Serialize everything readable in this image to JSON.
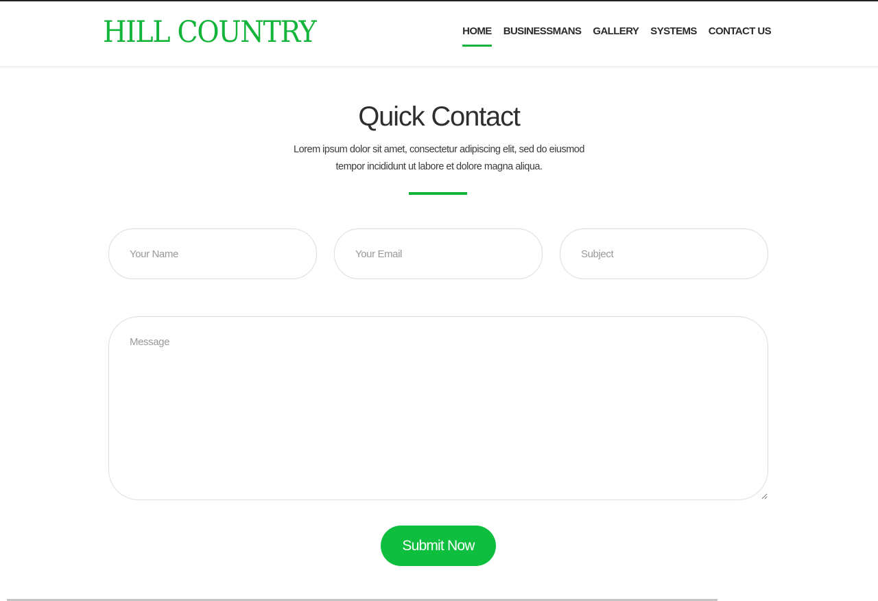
{
  "header": {
    "logo": "HILL COUNTRY",
    "nav": [
      {
        "label": "HOME",
        "active": true
      },
      {
        "label": "BUSINESSMANS",
        "active": false
      },
      {
        "label": "GALLERY",
        "active": false
      },
      {
        "label": "SYSTEMS",
        "active": false
      },
      {
        "label": "CONTACT US",
        "active": false
      }
    ]
  },
  "contact": {
    "title": "Quick Contact",
    "subtitle": "Lorem ipsum dolor sit amet, consectetur adipiscing elit, sed do eiusmod tempor incididunt ut labore et dolore magna aliqua.",
    "form": {
      "name_placeholder": "Your Name",
      "email_placeholder": "Your Email",
      "subject_placeholder": "Subject",
      "message_placeholder": "Message",
      "name_value": "",
      "email_value": "",
      "subject_value": "",
      "message_value": "",
      "submit_label": "Submit Now"
    }
  },
  "colors": {
    "accent": "#12b53a",
    "button": "#0ebf3f",
    "text": "#2e2e2e"
  }
}
